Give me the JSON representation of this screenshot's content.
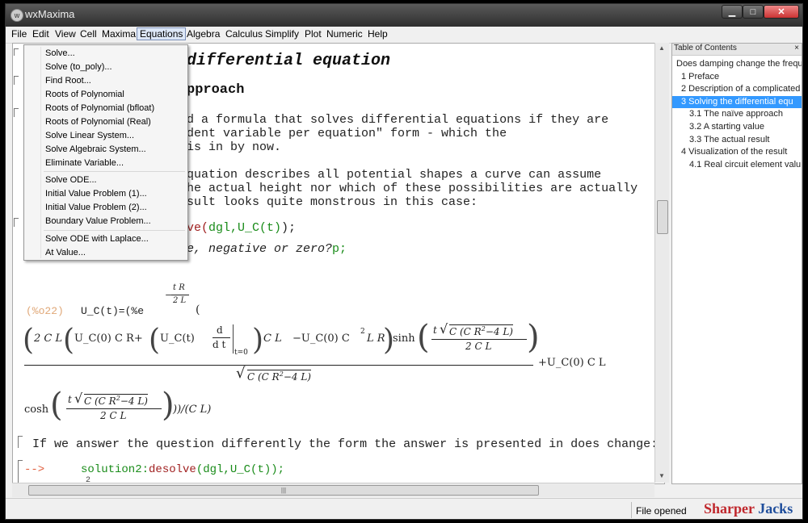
{
  "window": {
    "title": "wxMaxima",
    "controls": {
      "minimize": "▁",
      "maximize": "□",
      "close": "✕"
    }
  },
  "menu": [
    "File",
    "Edit",
    "View",
    "Cell",
    "Maxima",
    "Equations",
    "Algebra",
    "Calculus",
    "Simplify",
    "Plot",
    "Numeric",
    "Help"
  ],
  "dropdown": {
    "group1": [
      "Solve...",
      "Solve (to_poly)...",
      "Find Root...",
      "Roots of Polynomial",
      "Roots of Polynomial (bfloat)",
      "Roots of Polynomial (Real)",
      "Solve Linear System...",
      "Solve Algebraic System...",
      "Eliminate Variable..."
    ],
    "group2": [
      "Solve ODE...",
      "Initial Value Problem (1)...",
      "Initial Value Problem (2)...",
      "Boundary Value Problem..."
    ],
    "group3": [
      "Solve ODE with Laplace...",
      "At Value..."
    ]
  },
  "document": {
    "heading1": "differential equation",
    "heading2": "pproach",
    "para1": [
      "d a formula that solves differential equations if they are",
      "dent variable per equation\" form - which the",
      "is in by now."
    ],
    "para2": [
      "quation describes all potential shapes a curve can assume",
      "he actual height nor which of these possibilities are actually",
      "sult looks quite monstrous in this case:"
    ],
    "input1": {
      "prefix": "ve(",
      "args": "dgl,U_C(t)",
      "suffix": ");"
    },
    "input2": {
      "text": "e, negative or zero?",
      "tail": "p;"
    },
    "output": {
      "label": "(%o22)",
      "lhs": "U_C(t)=(%e",
      "exp_num": "t R",
      "exp_den": "2 L",
      "exp_sign": "−",
      "line2_a": "2 C L",
      "line2_b": "U_C(0) C R+",
      "line2_c": "U_C(t)",
      "d": "d",
      "dt": "d t",
      "t0": "t=0",
      "line2_d": "C L",
      "line2_e": "−U_C(0) C",
      "sq2": "2",
      "line2_f": "L R",
      "sinh": "sinh",
      "sinh_num_t": "t",
      "sinh_num_sqrt": "C (C R",
      "sinh_num_sq": "2",
      "sinh_num_tail": "−4 L)",
      "sinh_den": "2 C L",
      "den_sqrt": "C (C R",
      "den_sq": "2",
      "den_tail": "−4 L)",
      "plus": "+U_C(0) C L",
      "cosh": "cosh",
      "cosh_num_t": "t",
      "cosh_num_sqrt": "C (C R",
      "cosh_num_sq": "2",
      "cosh_num_tail": "−4 L)",
      "cosh_den": "2 C L",
      "cosh_tail": "))/(C L)"
    },
    "text3": "If we answer the question differently the form the answer is presented in does change:",
    "input3": {
      "prompt": "-->",
      "lhs": "solution2:",
      "func": "desolve",
      "args": "(dgl,U_C(t));"
    },
    "cut_line": "2"
  },
  "hscroll_grip": "|||",
  "toc": {
    "header": "Table of Contents",
    "close": "×",
    "items": [
      "Does damping change the frequ",
      "1 Preface",
      "2 Description of a complicated",
      "3 Solving the differential equ",
      "3.1 The naïve approach",
      "3.2 A starting value",
      "3.3 The actual result",
      "4 Visualization of the result",
      "4.1 Real circuit element valu"
    ],
    "selected_index": 3
  },
  "status": {
    "text": "File opened"
  },
  "watermark": {
    "part1": "Sharper",
    "part2": "Jacks",
    "color1": "#c0282d",
    "color2": "#1f4e9c"
  },
  "colors": {
    "output_label": "#e0a878",
    "input_prompt": "#e06040",
    "function": "#a02020",
    "argument": "#1a8c1a",
    "toc_selected": "#3399ff"
  }
}
